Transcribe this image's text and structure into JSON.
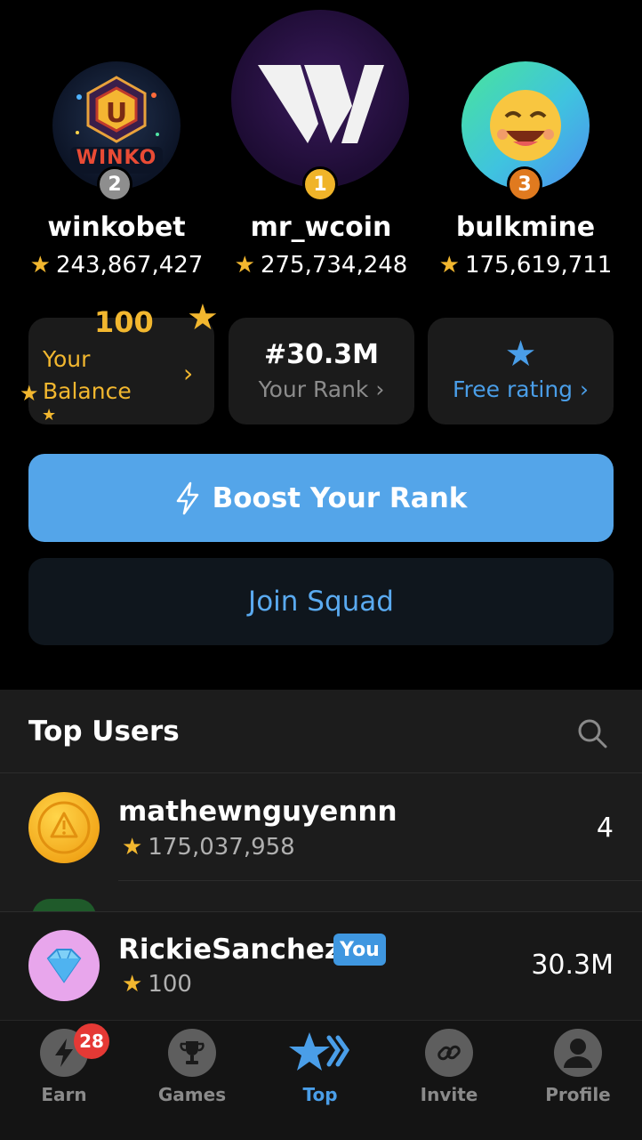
{
  "podium": [
    {
      "rank": "2",
      "name": "winkobet",
      "score": "243,867,427",
      "avatar_text": "WINKO"
    },
    {
      "rank": "1",
      "name": "mr_wcoin",
      "score": "275,734,248"
    },
    {
      "rank": "3",
      "name": "bulkmine",
      "score": "175,619,711"
    }
  ],
  "cards": {
    "balance": {
      "value": "100",
      "label_line1": "Your",
      "label_line2": "Balance",
      "chevron": "›"
    },
    "rank": {
      "value": "#30.3M",
      "label": "Your Rank",
      "chevron": "›"
    },
    "free": {
      "label": "Free rating",
      "chevron": "›"
    }
  },
  "buttons": {
    "boost": "Boost Your Rank",
    "squad": "Join Squad"
  },
  "list": {
    "title": "Top Users",
    "rows": [
      {
        "name": "mathewnguyennn",
        "score": "175,037,958",
        "rank": "4"
      }
    ]
  },
  "current_user": {
    "name": "RickieSanchez",
    "badge": "You",
    "score": "100",
    "rank": "30.3M"
  },
  "nav": {
    "items": [
      {
        "label": "Earn",
        "icon": "lightning-icon"
      },
      {
        "label": "Games",
        "icon": "trophy-icon"
      },
      {
        "label": "Top",
        "icon": "star-icon"
      },
      {
        "label": "Invite",
        "icon": "link-icon"
      },
      {
        "label": "Profile",
        "icon": "person-icon"
      }
    ],
    "earn_badge": "28",
    "active": "Top"
  },
  "colors": {
    "accent": "#54a5e9",
    "star": "#f2b72f",
    "gold": "#f0b429",
    "silver": "#8e8e8e",
    "bronze": "#e07a1f",
    "badge_red": "#e53935"
  }
}
